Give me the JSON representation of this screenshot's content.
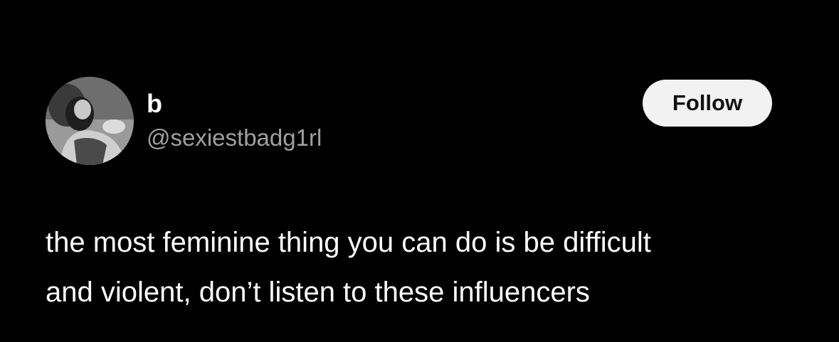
{
  "post": {
    "author": {
      "display_name": "b",
      "handle": "@sexiestbadg1rl",
      "avatar_icon": "profile-photo-avatar"
    },
    "follow_label": "Follow",
    "text_lines": [
      "the most feminine thing you can do is be difficult",
      "and violent, don’t listen to these influencers"
    ]
  },
  "colors": {
    "background": "#000000",
    "primary_text": "#ffffff",
    "secondary_text": "#a0a0a0",
    "button_bg": "#f2f2f2",
    "button_text": "#111111"
  }
}
